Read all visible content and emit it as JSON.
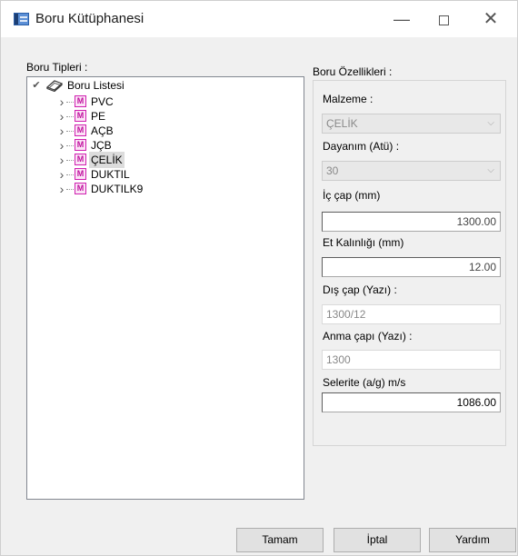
{
  "window": {
    "title": "Boru Kütüphanesi",
    "minimize_glyph": "—",
    "close_glyph": "✕"
  },
  "tree": {
    "label": "Boru Tipleri :",
    "root": "Boru Listesi",
    "icon_letter": "M",
    "items": [
      {
        "label": "PVC"
      },
      {
        "label": "PE"
      },
      {
        "label": "AÇB"
      },
      {
        "label": "JÇB"
      },
      {
        "label": "ÇELİK",
        "selected": true
      },
      {
        "label": "DUKTIL"
      },
      {
        "label": "DUKTILK9"
      }
    ]
  },
  "properties": {
    "group_label": "Boru Özellikleri :",
    "malzeme_label": "Malzeme :",
    "malzeme_value": "ÇELİK",
    "dayanim_label": "Dayanım (Atü) :",
    "dayanim_value": "30",
    "ic_cap_label": "İç çap  (mm)",
    "ic_cap_value": "1300.00",
    "et_kalinligi_label": "Et Kalınlığı  (mm)",
    "et_kalinligi_value": "12.00",
    "dis_cap_label": "Dış çap (Yazı) :",
    "dis_cap_value": "1300/12",
    "anma_cap_label": "Anma çapı (Yazı) :",
    "anma_cap_value": "1300",
    "selerite_label": "Selerite (a/g) m/s",
    "selerite_value": "1086.00"
  },
  "buttons": {
    "ok": "Tamam",
    "cancel": "İptal",
    "help": "Yardım"
  },
  "colors": {
    "window_bg": "#f0f0f0",
    "selection_bg": "#dcdcdc",
    "m_icon_accent": "#d01fb0"
  },
  "icons": {
    "app": "window-app-icon",
    "root": "book-icon",
    "item": "m-letter-icon",
    "expand": "chevron-right-icon",
    "expanded": "chevron-down-icon",
    "dropdown": "chevron-down-icon"
  }
}
